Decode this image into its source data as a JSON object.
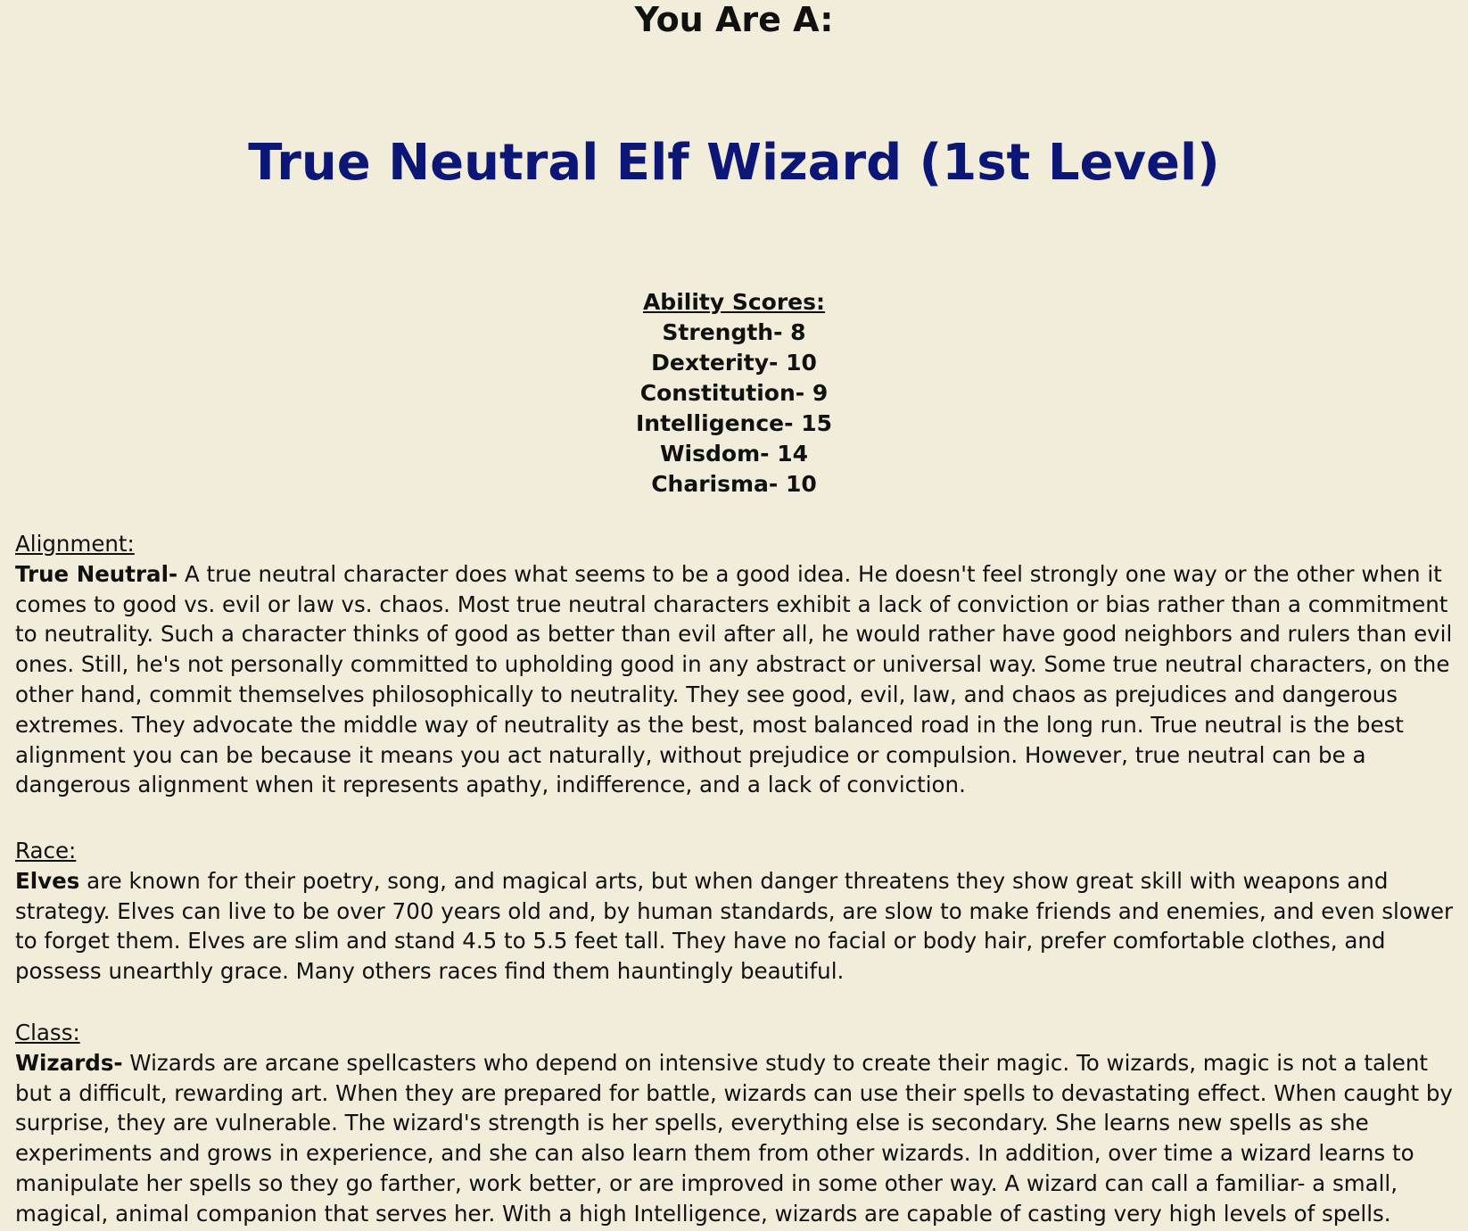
{
  "header": {
    "you_are": "You Are A:",
    "result": "True Neutral Elf Wizard (1st Level)"
  },
  "abilities": {
    "heading": "Ability Scores:",
    "rows": [
      "Strength- 8",
      "Dexterity- 10",
      "Constitution- 9",
      "Intelligence- 15",
      "Wisdom- 14",
      "Charisma- 10"
    ]
  },
  "alignment": {
    "label": "Alignment:",
    "lead": "True Neutral-",
    "text": " A true neutral character does what seems to be a good idea. He doesn't feel strongly one way or the other when it comes to good vs. evil or law vs. chaos. Most true neutral characters exhibit a lack of conviction or bias rather than a commitment to neutrality. Such a character thinks of good as better than evil after all, he would rather have good neighbors and rulers than evil ones. Still, he's not personally committed to upholding good in any abstract or universal way. Some true neutral characters, on the other hand, commit themselves philosophically to neutrality. They see good, evil, law, and chaos as prejudices and dangerous extremes. They advocate the middle way of neutrality as the best, most balanced road in the long run. True neutral is the best alignment you can be because it means you act naturally, without prejudice or compulsion. However, true neutral can be a dangerous alignment when it represents apathy, indifference, and a lack of conviction."
  },
  "race": {
    "label": "Race:",
    "lead": "Elves",
    "text": " are known for their poetry, song, and magical arts, but when danger threatens they show great skill with weapons and strategy. Elves can live to be over 700 years old and, by human standards, are slow to make friends and enemies, and even slower to forget them. Elves are slim and stand 4.5 to 5.5 feet tall. They have no facial or body hair, prefer comfortable clothes, and possess unearthly grace. Many others races find them hauntingly beautiful."
  },
  "class": {
    "label": "Class:",
    "lead": "Wizards-",
    "text": " Wizards are arcane spellcasters who depend on intensive study to create their magic. To wizards, magic is not a talent but a difficult, rewarding art. When they are prepared for battle, wizards can use their spells to devastating effect. When caught by surprise, they are vulnerable. The wizard's strength is her spells, everything else is secondary. She learns new spells as she experiments and grows in experience, and she can also learn them from other wizards. In addition, over time a wizard learns to manipulate her spells so they go farther, work better, or are improved in some other way. A wizard can call a familiar- a small, magical, animal companion that serves her. With a high Intelligence, wizards are capable of casting very high levels of spells."
  }
}
